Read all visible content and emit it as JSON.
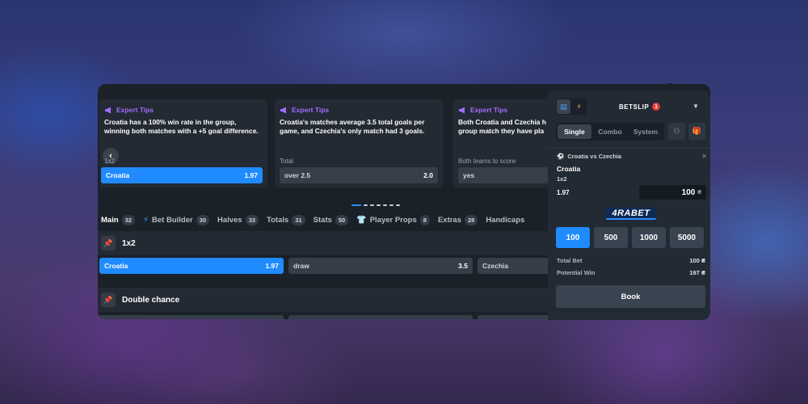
{
  "tips": [
    {
      "header": "Expert Tips",
      "text": "Croatia has a 100% win rate in the group, winning both matches with a +5 goal difference.",
      "market": "1x2",
      "selection": "Croatia",
      "odds": "1.97",
      "active": true
    },
    {
      "header": "Expert Tips",
      "text": "Croatia's matches average 3.5 total goals per game, and Czechia's only match had 3 goals.",
      "market": "Total",
      "selection": "over 2.5",
      "odds": "2.0",
      "active": false
    },
    {
      "header": "Expert Tips",
      "text": "Both Croatia and Czechia h group match they have pla",
      "market": "Both teams to score",
      "selection": "yes",
      "odds": "",
      "active": false
    }
  ],
  "tabs": [
    {
      "label": "Main",
      "count": "32",
      "icon": ""
    },
    {
      "label": "Bet Builder",
      "count": "30",
      "icon": "bet-builder-icon"
    },
    {
      "label": "Halves",
      "count": "33",
      "icon": ""
    },
    {
      "label": "Totals",
      "count": "31",
      "icon": ""
    },
    {
      "label": "Stats",
      "count": "50",
      "icon": ""
    },
    {
      "label": "Player Props",
      "count": "8",
      "icon": "jersey-icon"
    },
    {
      "label": "Extras",
      "count": "28",
      "icon": ""
    },
    {
      "label": "Handicaps",
      "count": "",
      "icon": ""
    }
  ],
  "markets": [
    {
      "title": "1x2",
      "outcomes": [
        {
          "label": "Croatia",
          "odds": "1.97",
          "active": true
        },
        {
          "label": "draw",
          "odds": "3.5",
          "active": false
        },
        {
          "label": "Czechia",
          "odds": "",
          "active": false
        }
      ]
    },
    {
      "title": "Double chance"
    }
  ],
  "betslip": {
    "title": "BETSLIP",
    "badge": "1",
    "modes": [
      "Single",
      "Combo",
      "System"
    ],
    "event": "Croatia vs Czechia",
    "pick": "Croatia",
    "market": "1x2",
    "odds": "1.97",
    "stake": "100",
    "currency": "₴",
    "brand": "4RABET",
    "quick_amounts": [
      "100",
      "500",
      "1000",
      "5000"
    ],
    "total_bet_label": "Total Bet",
    "total_bet_value": "100 ₴",
    "potential_win_label": "Potential Win",
    "potential_win_value": "197 ₴",
    "book_label": "Book"
  },
  "colors": {
    "accent": "#1f8bff",
    "tip_header": "#a46cff",
    "badge": "#e5393b"
  }
}
